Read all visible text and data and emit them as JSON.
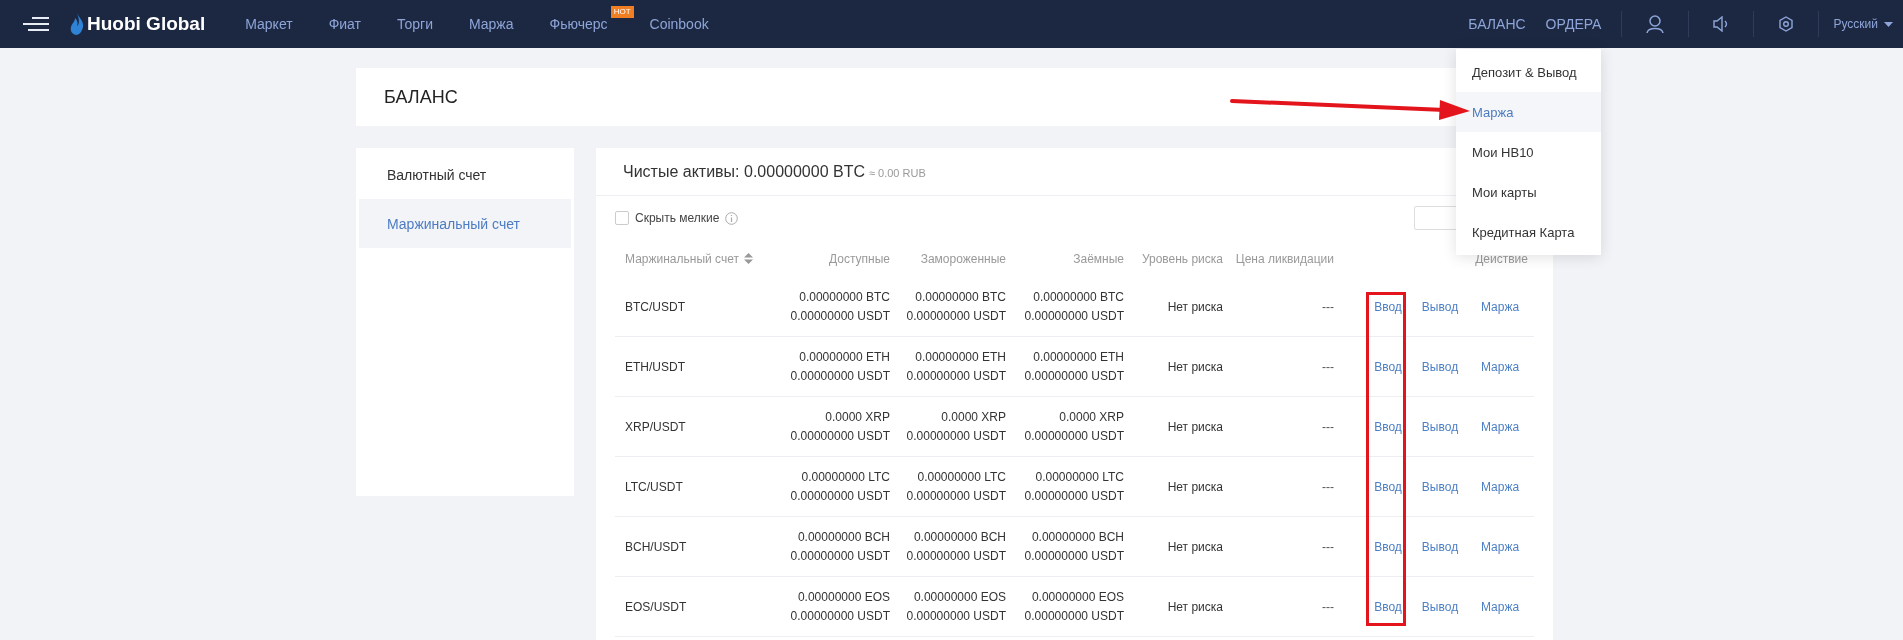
{
  "nav": {
    "logo": "Huobi Global",
    "menu": [
      {
        "label": "Маркет"
      },
      {
        "label": "Фиат"
      },
      {
        "label": "Торги"
      },
      {
        "label": "Маржа"
      },
      {
        "label": "Фьючерс",
        "badge": "HOT"
      },
      {
        "label": "Coinbook"
      }
    ],
    "right_links": [
      "БАЛАНС",
      "ОРДЕРА"
    ],
    "language": "Русский"
  },
  "dropdown": [
    {
      "label": "Депозит & Вывод",
      "selected": false
    },
    {
      "label": "Маржа",
      "selected": true
    },
    {
      "label": "Мои HB10",
      "selected": false
    },
    {
      "label": "Мои карты",
      "selected": false
    },
    {
      "label": "Кредитная Карта",
      "selected": false
    }
  ],
  "page_title": "БАЛАНС",
  "sidebar": [
    {
      "label": "Валютный счет",
      "selected": false
    },
    {
      "label": "Маржинальный счет",
      "selected": true
    }
  ],
  "summary": {
    "label": "Чистые активы: 0.00000000 BTC",
    "approx": "≈ 0.00 RUB"
  },
  "hide_small": {
    "label": "Скрыть мелкие",
    "checked": false
  },
  "columns": [
    {
      "label": "Маржинальный счет",
      "sortable": true
    },
    {
      "label": "Доступные",
      "sortable": false
    },
    {
      "label": "Замороженные",
      "sortable": false
    },
    {
      "label": "Заёмные",
      "sortable": false
    },
    {
      "label": "Уровень риска",
      "sortable": false
    },
    {
      "label": "Цена ликвидации",
      "sortable": false
    },
    {
      "label": "Действие",
      "sortable": false
    }
  ],
  "rows": [
    {
      "pair": "BTC/USDT",
      "available": [
        "0.00000000 BTC",
        "0.00000000 USDT"
      ],
      "frozen": [
        "0.00000000 BTC",
        "0.00000000 USDT"
      ],
      "borrowed": [
        "0.00000000 BTC",
        "0.00000000 USDT"
      ],
      "risk": "Нет риска",
      "liquidation": "---",
      "actions": [
        "Ввод",
        "Вывод",
        "Маржа"
      ]
    },
    {
      "pair": "ETH/USDT",
      "available": [
        "0.00000000 ETH",
        "0.00000000 USDT"
      ],
      "frozen": [
        "0.00000000 ETH",
        "0.00000000 USDT"
      ],
      "borrowed": [
        "0.00000000 ETH",
        "0.00000000 USDT"
      ],
      "risk": "Нет риска",
      "liquidation": "---",
      "actions": [
        "Ввод",
        "Вывод",
        "Маржа"
      ]
    },
    {
      "pair": "XRP/USDT",
      "available": [
        "0.0000 XRP",
        "0.00000000 USDT"
      ],
      "frozen": [
        "0.0000 XRP",
        "0.00000000 USDT"
      ],
      "borrowed": [
        "0.0000 XRP",
        "0.00000000 USDT"
      ],
      "risk": "Нет риска",
      "liquidation": "---",
      "actions": [
        "Ввод",
        "Вывод",
        "Маржа"
      ]
    },
    {
      "pair": "LTC/USDT",
      "available": [
        "0.00000000 LTC",
        "0.00000000 USDT"
      ],
      "frozen": [
        "0.00000000 LTC",
        "0.00000000 USDT"
      ],
      "borrowed": [
        "0.00000000 LTC",
        "0.00000000 USDT"
      ],
      "risk": "Нет риска",
      "liquidation": "---",
      "actions": [
        "Ввод",
        "Вывод",
        "Маржа"
      ]
    },
    {
      "pair": "BCH/USDT",
      "available": [
        "0.00000000 BCH",
        "0.00000000 USDT"
      ],
      "frozen": [
        "0.00000000 BCH",
        "0.00000000 USDT"
      ],
      "borrowed": [
        "0.00000000 BCH",
        "0.00000000 USDT"
      ],
      "risk": "Нет риска",
      "liquidation": "---",
      "actions": [
        "Ввод",
        "Вывод",
        "Маржа"
      ]
    },
    {
      "pair": "EOS/USDT",
      "available": [
        "0.00000000 EOS",
        "0.00000000 USDT"
      ],
      "frozen": [
        "0.00000000 EOS",
        "0.00000000 USDT"
      ],
      "borrowed": [
        "0.00000000 EOS",
        "0.00000000 USDT"
      ],
      "risk": "Нет риска",
      "liquidation": "---",
      "actions": [
        "Ввод",
        "Вывод",
        "Маржа"
      ]
    }
  ]
}
